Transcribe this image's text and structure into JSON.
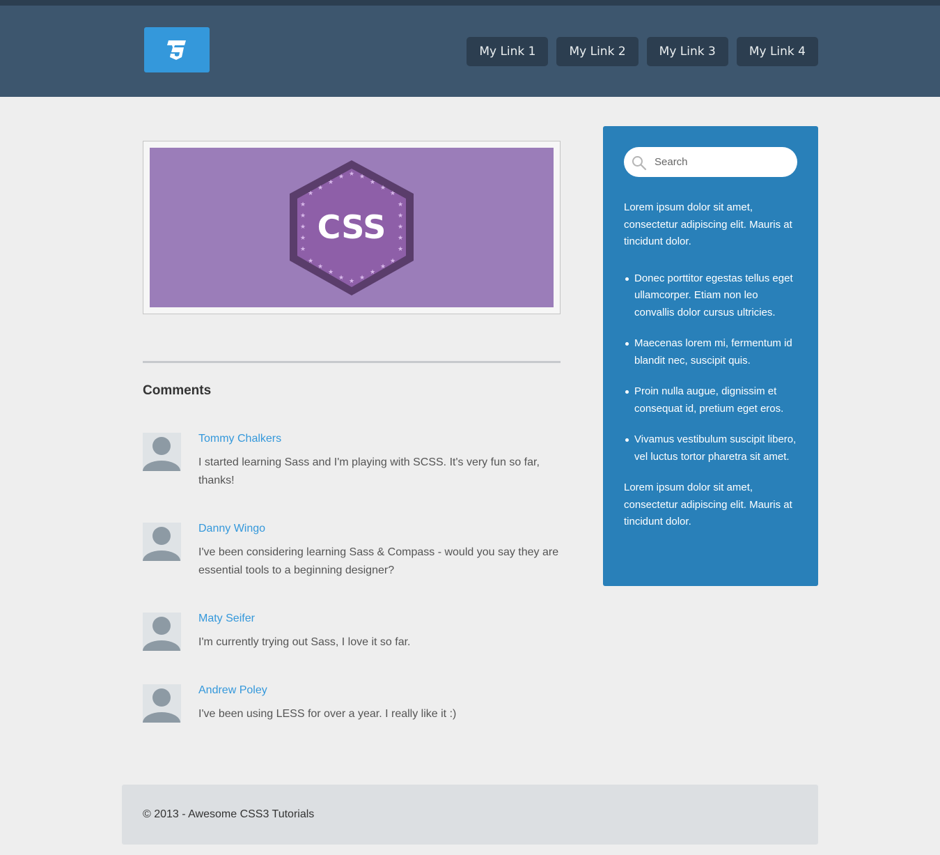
{
  "header": {
    "nav": [
      "My Link 1",
      "My Link 2",
      "My Link 3",
      "My Link 4"
    ]
  },
  "hero": {
    "badge_text": "CSS"
  },
  "comments": {
    "title": "Comments",
    "items": [
      {
        "name": "Tommy Chalkers",
        "text": "I started learning Sass and I'm playing with SCSS. It's very fun so far, thanks!"
      },
      {
        "name": "Danny Wingo",
        "text": "I've been considering learning Sass & Compass - would you say they are essential tools to a beginning designer?"
      },
      {
        "name": "Maty Seifer",
        "text": "I'm currently trying out Sass, I love it so far."
      },
      {
        "name": "Andrew Poley",
        "text": "I've been using LESS for over a year. I really like it :)"
      }
    ]
  },
  "sidebar": {
    "search_placeholder": "Search",
    "intro": "Lorem ipsum dolor sit amet, consectetur adipiscing elit. Mauris at tincidunt dolor.",
    "list": [
      "Donec porttitor egestas tellus eget ullamcorper. Etiam non leo convallis dolor cursus ultricies.",
      "Maecenas lorem mi, fermentum id blandit nec, suscipit quis.",
      "Proin nulla augue, dignissim et consequat id, pretium eget eros.",
      "Vivamus vestibulum suscipit libero, vel luctus tortor pharetra sit amet."
    ],
    "outro": "Lorem ipsum dolor sit amet, consectetur adipiscing elit. Mauris at tincidunt dolor."
  },
  "footer": {
    "text": "© 2013 - Awesome CSS3 Tutorials"
  },
  "colors": {
    "header": "#3d566e",
    "topbar": "#2c3e50",
    "accent": "#3498db",
    "sidebar": "#2980b9",
    "badge": "#9b7db9"
  }
}
